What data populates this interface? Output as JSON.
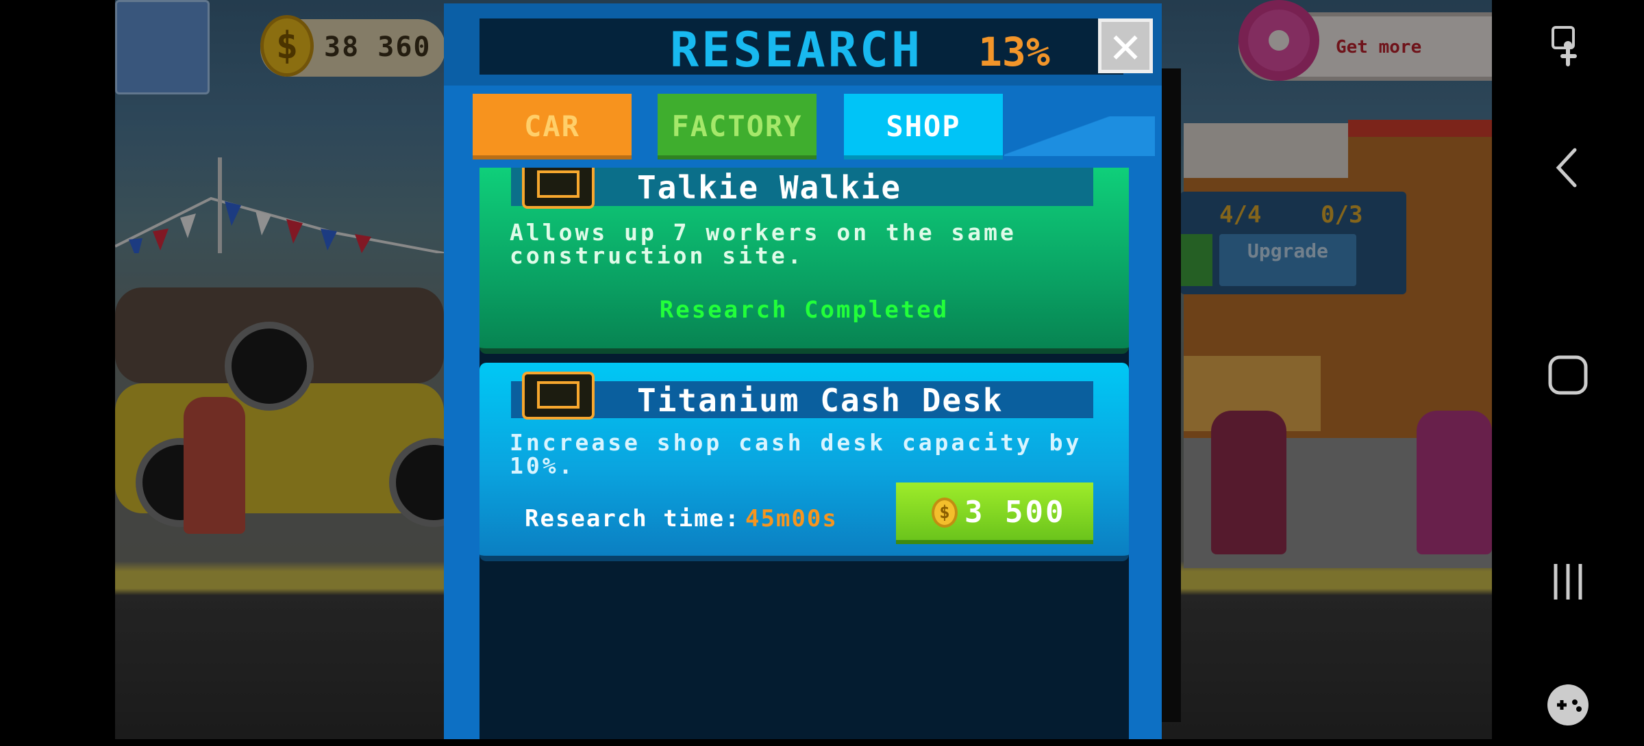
{
  "hud": {
    "coins_value": "38 360",
    "coin_icon": "dollar-coin-icon",
    "get_more_label": "Get more",
    "donut_icon": "donut-icon"
  },
  "background": {
    "cars_stat": "4/4",
    "workers_stat": "0/3",
    "upgrade_label": "Upgrade"
  },
  "dialog": {
    "title": "RESEARCH",
    "percent": "13%",
    "close_glyph": "✕",
    "tabs": [
      {
        "label": "CAR"
      },
      {
        "label": "FACTORY"
      },
      {
        "label": "SHOP"
      }
    ],
    "active_tab": "SHOP",
    "cards": [
      {
        "title": "Talkie Walkie",
        "description": "Allows up 7 workers on the same construction site.",
        "status": "Research Completed",
        "icon": "walkie-talkie-icon"
      },
      {
        "title": "Titanium Cash Desk",
        "description": "Increase shop cash desk capacity by 10%.",
        "research_time_label": "Research time:",
        "research_time_value": "45m00s",
        "price": "3 500",
        "coin_glyph": "$",
        "icon": "cash-desk-icon"
      }
    ]
  },
  "navbar": {
    "icons": [
      "accessibility-touch-icon",
      "back-icon",
      "home-icon",
      "recents-icon",
      "game-launcher-icon"
    ]
  },
  "colors": {
    "title": "#18b9f0",
    "percent": "#f2952a",
    "tab_car": "#f7931e",
    "tab_factory": "#3fae2e",
    "tab_shop": "#00c4f7",
    "completed_text": "#22ff3a",
    "buy_button": "#7fd320"
  }
}
